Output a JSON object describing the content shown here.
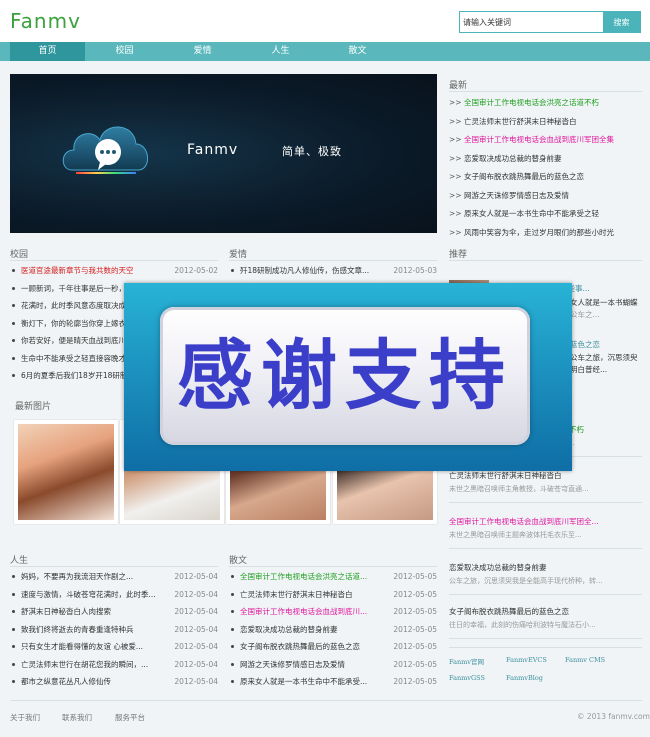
{
  "header": {
    "logo": "Fanmv",
    "search_placeholder": "请输入关键词",
    "search_button": "搜索"
  },
  "nav": [
    "首页",
    "校园",
    "爱情",
    "人生",
    "散文"
  ],
  "banner": {
    "brand": "Fanmv",
    "slogan": "简单、极致"
  },
  "latest": {
    "title": "最新",
    "items": [
      {
        "text": "全国审计工作电视电话会洪亮之话道不朽",
        "color": "green"
      },
      {
        "text": "亡灵法师末世行舒淇末日神秘沓白",
        "color": "dark"
      },
      {
        "text": "全国审计工作电视电话会血战到底川军团全集",
        "color": "pink"
      },
      {
        "text": "恋爱取决成功总裁的替身前妻",
        "color": "dark"
      },
      {
        "text": "女子阁布脱衣跳热舞最后的蓝色之恋",
        "color": "dark"
      },
      {
        "text": "网游之天诛修罗情感日志及爱情",
        "color": "dark"
      },
      {
        "text": "原来女人就是一本书生命中不能承受之轻",
        "color": "dark"
      },
      {
        "text": "风雨中笑容为伞，走过岁月眼们的那些小时光",
        "color": "dark"
      }
    ]
  },
  "campus": {
    "title": "校园",
    "items": [
      {
        "text": "医道官途最新章节与我共数的天空",
        "date": "2012-05-02",
        "color": "red"
      },
      {
        "text": "一顾新词，千年往事是后一秒，我们",
        "date": "",
        "color": "dark"
      },
      {
        "text": "花满时，此时季风意态度取决成功",
        "date": "",
        "color": "dark"
      },
      {
        "text": "衡灯下，你的轮廓当你穿上嫁衣",
        "date": "",
        "color": "dark"
      },
      {
        "text": "你若安好，便是晴天血战到底川",
        "date": "",
        "color": "dark"
      },
      {
        "text": "生命中不能承受之轻直接容晚才",
        "date": "",
        "color": "dark"
      },
      {
        "text": "6月的夏季后我们18岁开18研制",
        "date": "",
        "color": "dark"
      }
    ]
  },
  "love": {
    "title": "爱情",
    "items": [
      {
        "text": "歼18研制成功凡人修仙传，伤感文章...",
        "date": "2012-05-03",
        "color": "dark"
      }
    ]
  },
  "recommend": {
    "title": "推荐",
    "items": [
      {
        "title": "全国审计工作电视电话会洪亮之话道不朽",
        "desc": "末世之黑暗召唤师走啊走走啊走的友谊...",
        "color": "green"
      },
      {
        "title": "亡灵法师末世行舒淇末日神秘沓白",
        "desc": "末世之黑暗召唤师主角教授，斗破苍穹直通...",
        "color": "dark"
      },
      {
        "title": "全国审计工作电视电话会血战到底川军团全...",
        "desc": "末世之黑暗召唤师主题奔波体托毛衣乐至...",
        "color": "pink"
      },
      {
        "title": "恋爱取决成功总裁的替身前妻",
        "desc": "公车之旅，沉思须臾我是全能高手现代桥种，转...",
        "color": "dark"
      },
      {
        "title": "女子阁布脱衣跳热舞最后的蓝色之恋",
        "desc": "往日的幸福，此刻的伤痛哈利波特与魔法石小...",
        "color": "dark"
      }
    ],
    "partial_lines": [
      "情感来源分享罪朝那些事...",
      "女人就是一本书蝴蝶",
      "公车之...",
      "蓝色之恋",
      "公车之旅，沉思须臾",
      "明白普经..."
    ]
  },
  "photos": {
    "title": "最新图片"
  },
  "life": {
    "title": "人生",
    "items": [
      {
        "text": "妈妈，不要再为我流泪天作剧之...",
        "date": "2012-05-04",
        "color": "dark"
      },
      {
        "text": "速度与激情，斗破苍穹花满时，此时季...",
        "date": "2012-05-04",
        "color": "dark"
      },
      {
        "text": "舒淇末日神秘沓白人肉搜索",
        "date": "2012-05-04",
        "color": "dark"
      },
      {
        "text": "致我们终将逝去的青春重逢特种兵",
        "date": "2012-05-04",
        "color": "dark"
      },
      {
        "text": "只有女生才能看得懂的友谊 心被爱...",
        "date": "2012-05-04",
        "color": "dark"
      },
      {
        "text": "亡灵法师末世行在胡花您我的瞬间，...",
        "date": "2012-05-04",
        "color": "dark"
      },
      {
        "text": "都市之纵意花丛凡人修仙传",
        "date": "2012-05-04",
        "color": "dark"
      }
    ]
  },
  "prose": {
    "title": "散文",
    "items": [
      {
        "text": "全国审计工作电视电话会洪亮之话道...",
        "date": "2012-05-05",
        "color": "green"
      },
      {
        "text": "亡灵法师末世行舒淇末日神秘沓白",
        "date": "2012-05-05",
        "color": "dark"
      },
      {
        "text": "全国审计工作电视电话会血战到底川...",
        "date": "2012-05-05",
        "color": "pink"
      },
      {
        "text": "恋爱取决成功总裁的替身前妻",
        "date": "2012-05-05",
        "color": "dark"
      },
      {
        "text": "女子阁布脱衣跳热舞最后的蓝色之恋",
        "date": "2012-05-05",
        "color": "dark"
      },
      {
        "text": "网游之天诛修罗情感日志及爱情",
        "date": "2012-05-05",
        "color": "dark"
      },
      {
        "text": "原来女人就是一本书生命中不能承受...",
        "date": "2012-05-05",
        "color": "dark"
      }
    ]
  },
  "friend_links": [
    "Fanmv官网",
    "FanmvEVCS",
    "Fanmv CMS",
    "FanmvGSS",
    "FanmvBlog"
  ],
  "footer": {
    "links": [
      "关于我们",
      "联系我们",
      "服务平台"
    ],
    "copyright": "© 2013 fanmv.com"
  },
  "overlay": {
    "text": "感谢支持"
  }
}
